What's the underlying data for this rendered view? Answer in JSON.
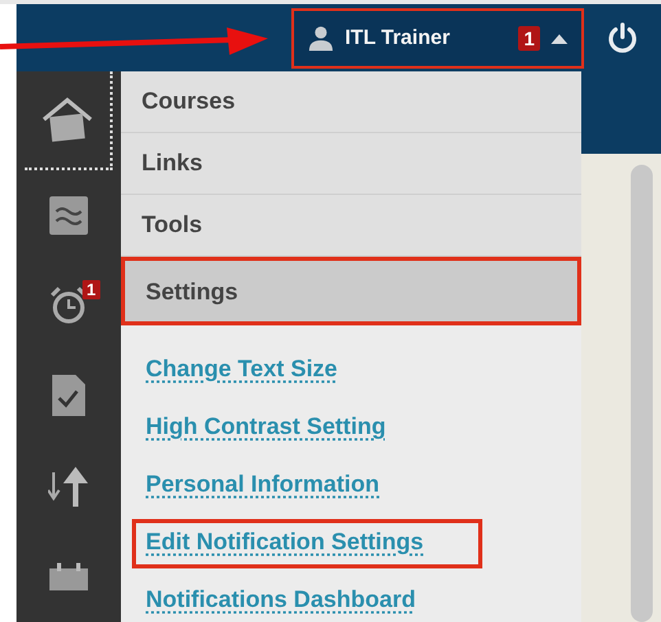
{
  "user_menu": {
    "name": "ITL Trainer",
    "badge": "1",
    "expanded": true,
    "highlighted": true
  },
  "sidebar": {
    "items": [
      {
        "kind": "home",
        "selected": true
      },
      {
        "kind": "grades",
        "selected": false
      },
      {
        "kind": "alarm",
        "selected": false,
        "badge": "1"
      },
      {
        "kind": "document",
        "selected": false
      },
      {
        "kind": "arrows",
        "selected": false
      },
      {
        "kind": "calendar",
        "selected": false
      }
    ]
  },
  "menu": {
    "sections": [
      {
        "label": "Courses",
        "selected": false,
        "highlighted": false
      },
      {
        "label": "Links",
        "selected": false,
        "highlighted": false
      },
      {
        "label": "Tools",
        "selected": false,
        "highlighted": false
      },
      {
        "label": "Settings",
        "selected": true,
        "highlighted": true
      }
    ],
    "links": [
      {
        "label": "Change Text Size",
        "highlighted": false
      },
      {
        "label": "High Contrast Setting",
        "highlighted": false
      },
      {
        "label": "Personal Information",
        "highlighted": false
      },
      {
        "label": "Edit Notification Settings",
        "highlighted": true
      },
      {
        "label": "Notifications Dashboard",
        "highlighted": false
      }
    ]
  }
}
